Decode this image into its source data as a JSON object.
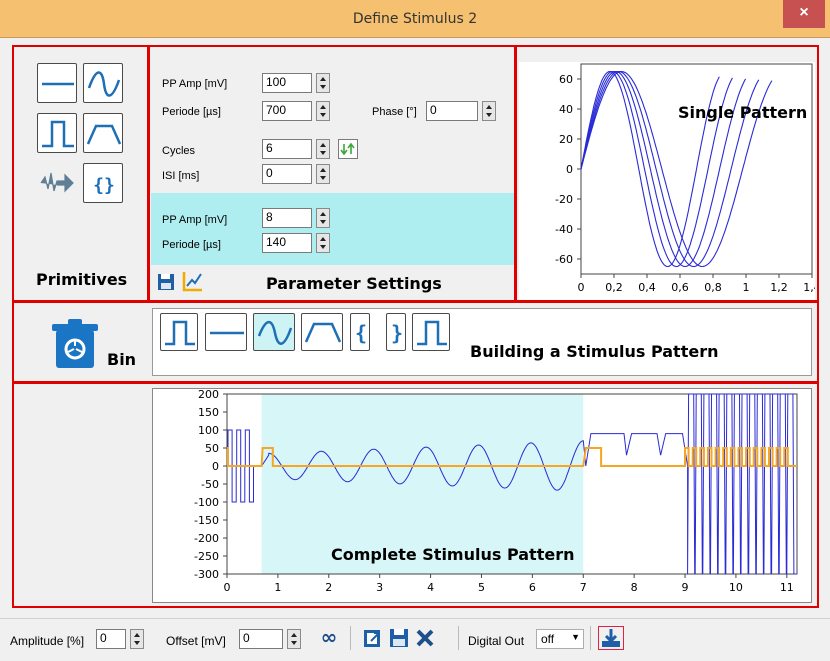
{
  "window": {
    "title": "Define Stimulus 2",
    "close_label": "×"
  },
  "primitives": {
    "label": "Primitives",
    "icons": [
      "line-icon",
      "sine-icon",
      "pulse-icon",
      "trapezoid-icon",
      "noise-icon",
      "braces-icon"
    ]
  },
  "params": {
    "section_label": "Parameter Settings",
    "pp_amp_label": "PP Amp [mV]",
    "pp_amp_value": "100",
    "periode_label": "Periode [µs]",
    "periode_value": "700",
    "phase_label": "Phase [°]",
    "phase_value": "0",
    "cycles_label": "Cycles",
    "cycles_value": "6",
    "isi_label": "ISI [ms]",
    "isi_value": "0",
    "pp_amp2_label": "PP Amp [mV]",
    "pp_amp2_value": "8",
    "periode2_label": "Periode [µs]",
    "periode2_value": "140"
  },
  "single_pattern": {
    "label": "Single Pattern"
  },
  "builder": {
    "label": "Building a Stimulus Pattern",
    "bin_label": "Bin",
    "items": [
      "pulse",
      "line",
      "sine",
      "trapezoid",
      "brace-open",
      "brace-close",
      "pulse"
    ]
  },
  "complete_pattern": {
    "label": "Complete Stimulus Pattern"
  },
  "toolbar": {
    "amplitude_label": "Amplitude [%]",
    "amplitude_value": "0",
    "offset_label": "Offset [mV]",
    "offset_value": "0",
    "digital_out_label": "Digital Out",
    "digital_out_value": "off"
  },
  "chart_data": [
    {
      "type": "line",
      "name": "single-pattern",
      "xlim": [
        0,
        1.4
      ],
      "ylim": [
        -70,
        70
      ],
      "x_ticks": [
        "0",
        "0,2",
        "0,4",
        "0,6",
        "0,8",
        "1",
        "1,2",
        "1,4"
      ],
      "y_ticks": [
        "60",
        "40",
        "20",
        "0",
        "-20",
        "-40",
        "-60"
      ],
      "series": [
        {
          "amplitude": 50,
          "period": 0.7
        },
        {
          "amplitude": 50,
          "period": 0.77
        },
        {
          "amplitude": 50,
          "period": 0.84
        },
        {
          "amplitude": 50,
          "period": 0.91
        },
        {
          "amplitude": 50,
          "period": 0.98
        }
      ],
      "grid": false
    },
    {
      "type": "line",
      "name": "complete-pattern",
      "xlim": [
        0,
        11.2
      ],
      "ylim": [
        -300,
        200
      ],
      "x_ticks": [
        "0",
        "1",
        "2",
        "3",
        "4",
        "5",
        "6",
        "7",
        "8",
        "9",
        "10",
        "11"
      ],
      "y_ticks": [
        "200",
        "150",
        "100",
        "50",
        "0",
        "-50",
        "-100",
        "-150",
        "-200",
        "-250",
        "-300"
      ],
      "highlight_range": [
        0.68,
        7.0
      ],
      "grid": false
    }
  ],
  "colors": {
    "frame_red": "#e10000",
    "trace_blue": "#2a2ad6",
    "digital_orange": "#f5a623",
    "highlight_cyan": "#aeeef0"
  }
}
